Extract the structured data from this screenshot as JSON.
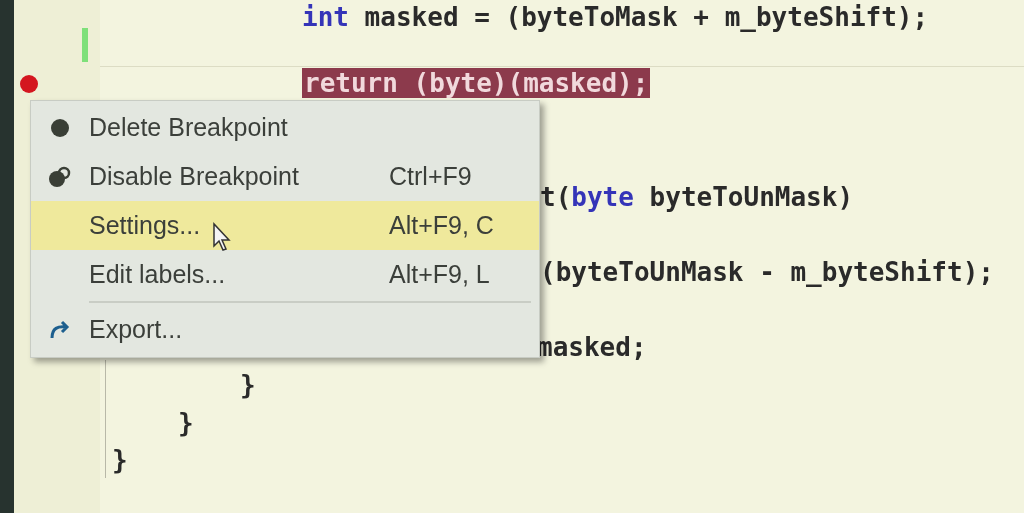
{
  "code_lines": [
    {
      "parts": [
        {
          "text": "int",
          "kind": "keyword"
        },
        {
          "text": " masked = (byteToMask + m_byteShift);",
          "kind": "plain"
        }
      ],
      "highlighted": false
    },
    {
      "parts": [
        {
          "text": "return (byte)(masked);",
          "kind": "plain"
        }
      ],
      "highlighted": true,
      "breakpoint": true
    },
    {
      "parts": [
        {
          "text": "t(",
          "kind": "plain"
        },
        {
          "text": "byte",
          "kind": "keyword"
        },
        {
          "text": " byteToUnMask)",
          "kind": "plain"
        }
      ],
      "highlighted": false
    },
    {
      "parts": [
        {
          "text": "(byteToUnMask - m_byteShift);",
          "kind": "plain"
        }
      ],
      "highlighted": false
    },
    {
      "parts": [
        {
          "text": "masked;",
          "kind": "plain"
        }
      ],
      "highlighted": false
    },
    {
      "parts": [
        {
          "text": "}",
          "kind": "plain"
        }
      ],
      "highlighted": false
    },
    {
      "parts": [
        {
          "text": "}",
          "kind": "plain"
        }
      ],
      "highlighted": false
    },
    {
      "parts": [
        {
          "text": "}",
          "kind": "plain"
        }
      ],
      "highlighted": false
    }
  ],
  "context_menu": {
    "items": [
      {
        "kind": "command",
        "label": "Delete Breakpoint",
        "selected": false
      },
      {
        "kind": "command",
        "label": "Disable Breakpoint",
        "shortcut": "Ctrl+F9",
        "selected": false
      },
      {
        "kind": "command",
        "label": "Settings...",
        "shortcut": "Alt+F9, C",
        "selected": true
      },
      {
        "kind": "command",
        "label": "Edit labels...",
        "shortcut": "Alt+F9, L",
        "selected": false
      },
      {
        "kind": "separator"
      },
      {
        "kind": "command",
        "label": "Export...",
        "selected": false
      }
    ]
  }
}
